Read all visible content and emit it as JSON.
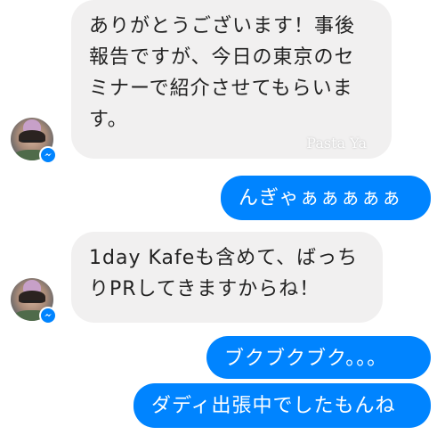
{
  "conversation": {
    "messages": [
      {
        "sender": "other",
        "lines": [
          "ありがとうございます！事後",
          "報告ですが、今日の東京のセ",
          "ミナーで紹介させてもらいま",
          "す。"
        ],
        "watermark": "Pasta Ya"
      },
      {
        "sender": "me",
        "lines": [
          "んぎゃぁぁぁぁぁ"
        ]
      },
      {
        "sender": "other",
        "lines": [
          "1day Kafeも含めて、ばっち",
          "りPRしてきますからね！"
        ]
      },
      {
        "sender": "me",
        "lines": [
          "ブクブクブク。。。"
        ]
      },
      {
        "sender": "me",
        "lines": [
          "ダディ出張中でしたもんね"
        ]
      }
    ]
  },
  "theme": {
    "incoming_bubble": "#f1f0f0",
    "outgoing_bubble": "#0084ff",
    "badge_icon": "messenger-icon"
  }
}
